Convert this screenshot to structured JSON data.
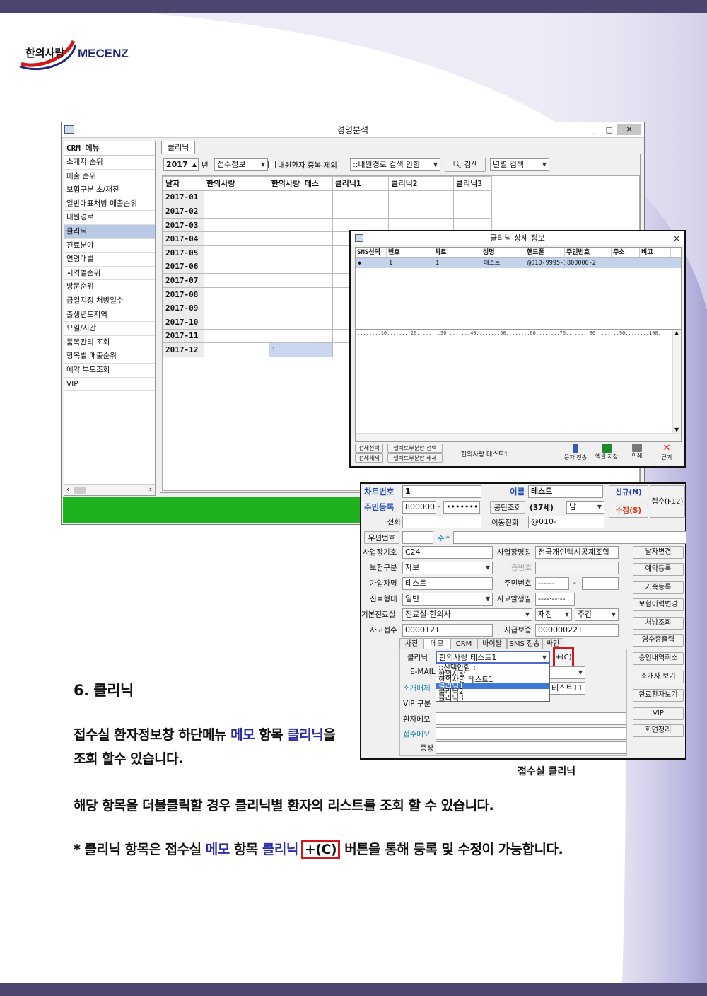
{
  "logo": {
    "brand_ko": "한의사랑",
    "brand_en": "MECENZ"
  },
  "main_window": {
    "title": "경영분석",
    "controls": [
      "_",
      "□",
      "×"
    ],
    "menu_header": "CRM 메뉴",
    "menu_items": [
      "소개자 순위",
      "매출 순위",
      "보험구분 초/재진",
      "일반대표처방 매출순위",
      "내원경로",
      "클리닉",
      "진료분야",
      "연령대별",
      "지역별순위",
      "방문순위",
      "금일지정 처방일수",
      "출생년도지역",
      "요일/시간",
      "품목관리 조회",
      "항목별 매출순위",
      "예약 부도조회",
      "VIP"
    ],
    "tab": "클리닉",
    "year": "2017",
    "year_suffix": "년",
    "filter_select": "접수정보",
    "checkbox_label": "내원환자 중복 제외",
    "route_select": "::내원경로 검색 안함",
    "search_label": "검색",
    "year_search": "년별 검색",
    "columns": [
      "날자",
      "한의사랑",
      "한의사랑 테스",
      "클리닉1",
      "클리닉2",
      "클리닉3"
    ],
    "rows": [
      "2017-01",
      "2017-02",
      "2017-03",
      "2017-04",
      "2017-05",
      "2017-06",
      "2017-07",
      "2017-08",
      "2017-09",
      "2017-10",
      "2017-11",
      "2017-12"
    ],
    "cell_value": "1"
  },
  "detail_window": {
    "title": "클리닉 상세 정보",
    "close": "×",
    "columns": [
      "SMS선택",
      "번호",
      "차트",
      "성명",
      "핸드폰",
      "주민번호",
      "주소",
      "비고"
    ],
    "row": [
      "◆",
      "1",
      "1",
      "테스트",
      "@010-9995-16",
      "800000-2",
      "",
      ""
    ],
    "ruler": "........10........20........30........40........50........60........70........80........90........100.",
    "btn_select_all": "전체선택",
    "btn_deselect_all": "전체해제",
    "btn_sel_part": "셀렉트부분만 선택",
    "btn_desel_part": "셀렉트부분만 해제",
    "patient_label": "한의사랑 테스트1",
    "sms_send": "문자 전송",
    "excel_save": "엑셀 저장",
    "print": "인쇄",
    "close_btn": "닫기"
  },
  "reception": {
    "chart_no_label": "차트번호",
    "chart_no": "1",
    "name_label": "이름",
    "name": "테스트",
    "btn_new": "신규(N)",
    "btn_edit": "수정(S)",
    "btn_receive": "접수(F12)",
    "rrn_label": "주민등록",
    "rrn1": "800000",
    "rrn2": "•••••••",
    "gongdan": "공단조회",
    "age": "(37세)",
    "sex": "남",
    "phone_label": "전화",
    "mobile_label": "이동전화",
    "mobile": "@010-",
    "zip_label": "우편번호",
    "addr_label": "주소",
    "biz_code_label": "사업장기호",
    "biz_code": "C24",
    "biz_name_label": "사업장명칭",
    "biz_name": "전국개인택시공제조합",
    "ins_label": "보험구분",
    "ins": "자보",
    "cert_label": "증번호",
    "member_label": "가입자명",
    "member": "테스트",
    "rrn_label2": "주민번호",
    "rrn_mask": "------",
    "dash": "-",
    "type_label": "진료형태",
    "type": "일반",
    "acc_date_label": "사고발생일",
    "acc_date": "----·--·--",
    "room_label": "기본진료실",
    "room": "진료실-한의사",
    "visit": "재진",
    "time": "주간",
    "acc_no_label": "사고접수",
    "acc_no": "0000121",
    "guar_label": "지급보증",
    "guar": "000000221",
    "tabs": [
      "사진",
      "메모",
      "CRM",
      "바이탈",
      "SMS 전송",
      "싸인"
    ],
    "clinic_label": "클리닉",
    "clinic_value": "한의사랑 테스트1",
    "plus_c": "+(C)",
    "dropdown": [
      "::선택안함::",
      "한의사랑",
      "한의사랑 테스트1",
      "클리닉1",
      "클리닉2",
      "클리닉3"
    ],
    "email_label": "E-MAIL",
    "referral_label": "소개매체",
    "referral_value": "테스트11",
    "vip_label": "VIP 구분",
    "memo_label": "환자메모",
    "rec_memo_label": "접수메모",
    "symptom_label": "증상",
    "side_buttons": [
      "날자변경",
      "예약등록",
      "가족등록",
      "보험이력변경",
      "처방조회",
      "영수증출력",
      "승인내역취소",
      "소개자 보기",
      "완료환자보기",
      "VIP",
      "화면정리"
    ]
  },
  "caption": "접수실 클리닉",
  "doc": {
    "heading": "6. 클리닉",
    "p1_a": "접수실 환자정보창 하단메뉴 ",
    "p1_memo": "메모",
    "p1_b": " 항목 ",
    "p1_clinic": "클리닉",
    "p1_c": "을",
    "p1_line2": "조회 할수 있습니다.",
    "p2": "해당 항목을 더블클릭할 경우 클리닉별 환자의 리스트를 조회 할 수 있습니다.",
    "p3_a": "* 클리닉 항목은 접수실 ",
    "p3_memo": "메모",
    "p3_b": " 항목 ",
    "p3_clinic": "클리닉",
    "p3_btn": "+(C)",
    "p3_c": " 버튼을 통해 등록 및 수정이 가능합니다."
  }
}
